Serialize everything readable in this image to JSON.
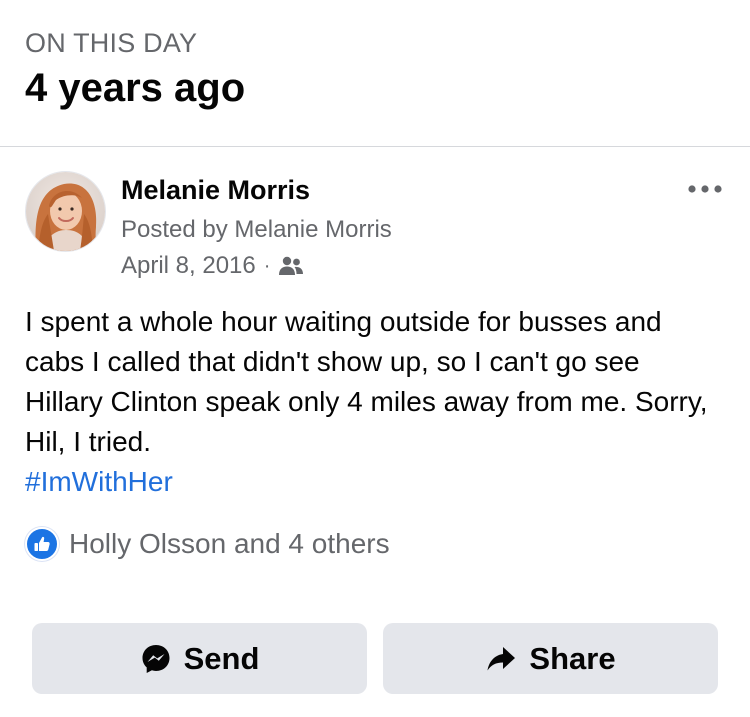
{
  "memory": {
    "kicker": "ON THIS DAY",
    "title": "4 years ago"
  },
  "post": {
    "author_name": "Melanie Morris",
    "posted_by": "Posted by Melanie Morris",
    "date": "April 8, 2016",
    "separator": "·",
    "audience_icon": "friends-icon",
    "text": "I spent a whole hour waiting outside for busses and cabs I called that didn't show up, so I can't go see Hillary Clinton speak only 4 miles away from me. Sorry, Hil, I tried.",
    "hashtag": "#ImWithHer",
    "more_icon": "more-options-icon"
  },
  "reactions": {
    "icon": "like-icon",
    "text": "Holly Olsson and 4 others"
  },
  "actions": {
    "send_label": "Send",
    "send_icon": "messenger-icon",
    "share_label": "Share",
    "share_icon": "share-arrow-icon"
  },
  "colors": {
    "secondary_text": "#65676b",
    "hashtag_blue": "#216fdb",
    "like_blue": "#1b74e4",
    "button_bg": "#e4e6eb"
  }
}
